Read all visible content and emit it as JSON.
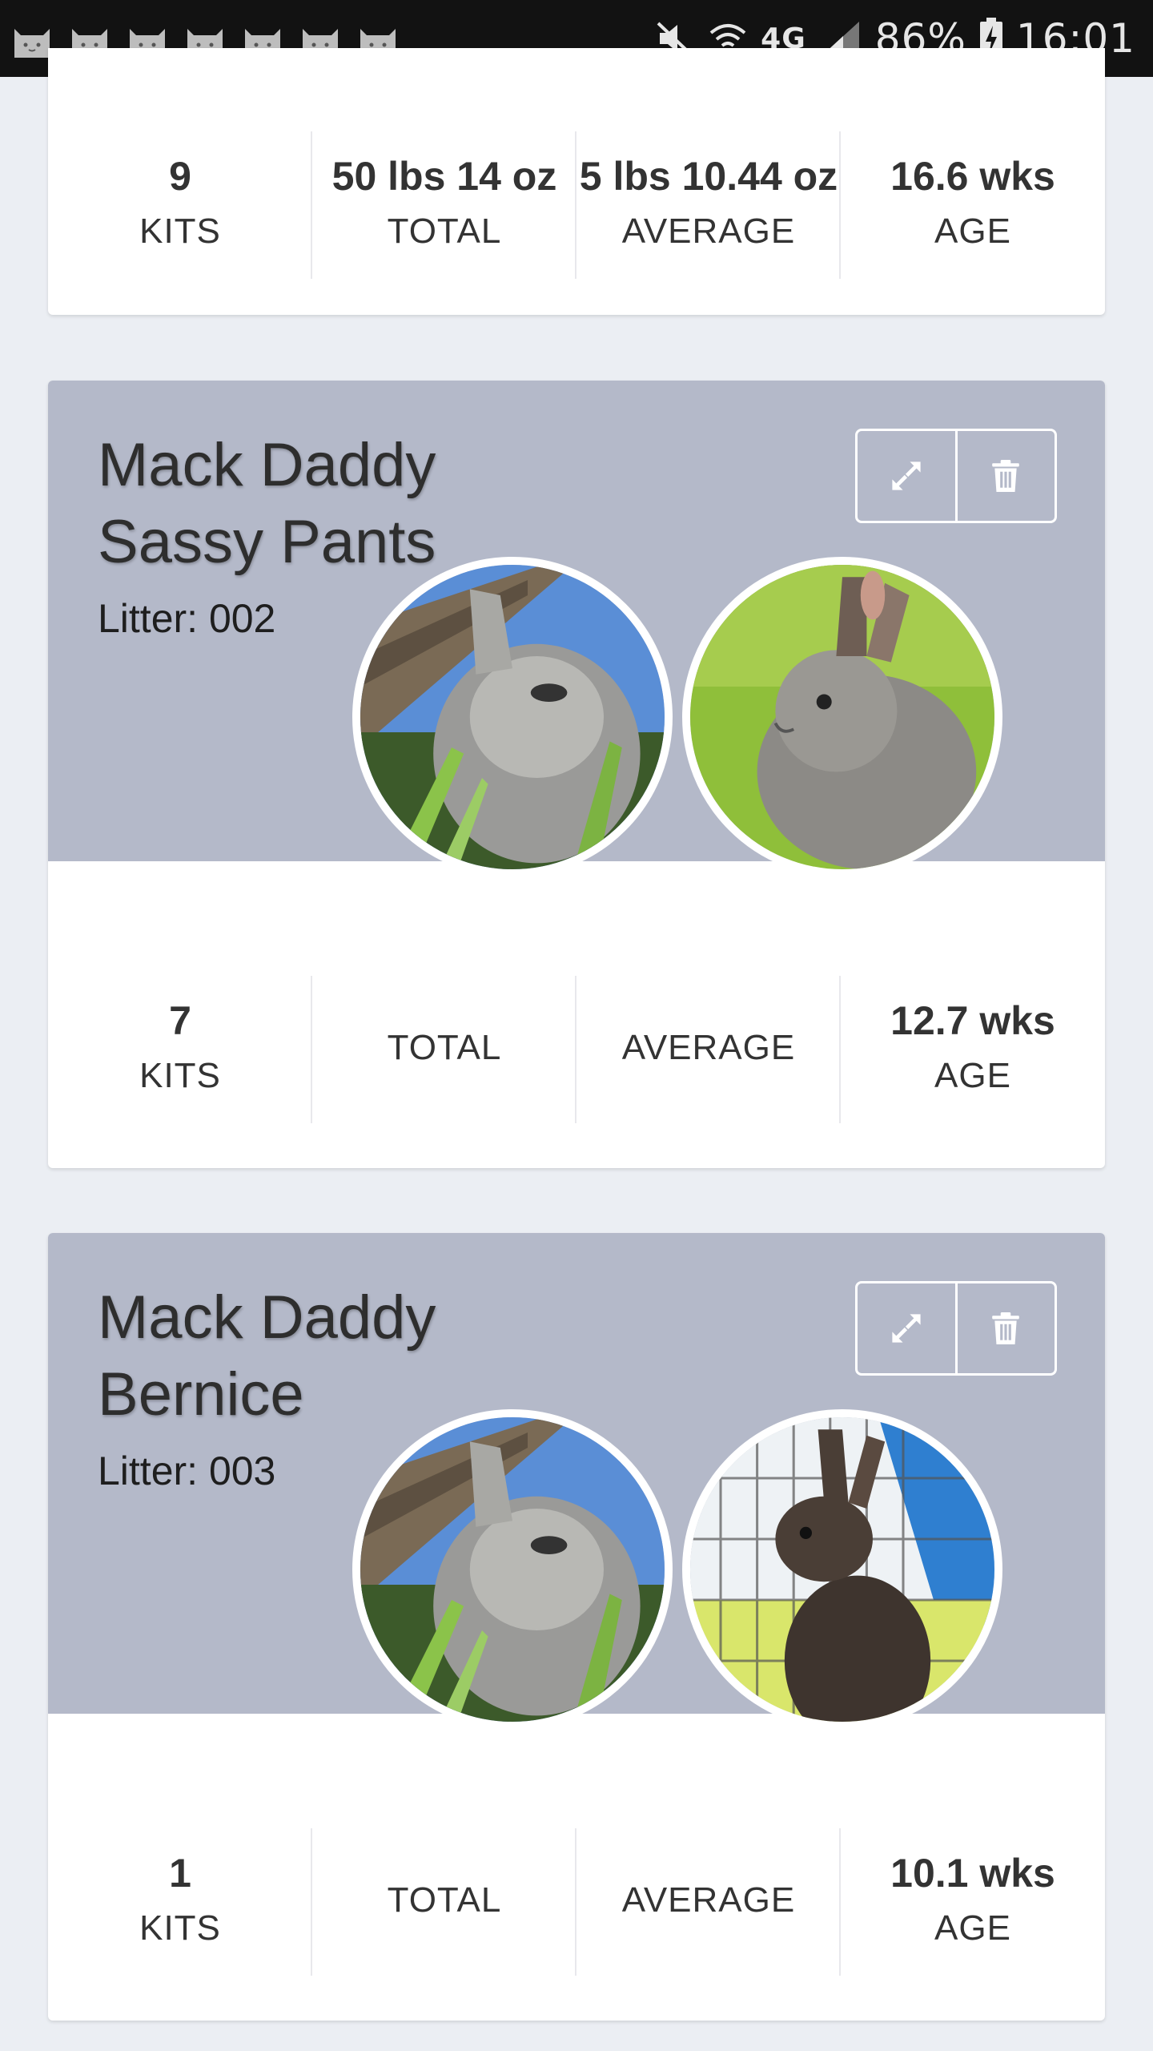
{
  "status_bar": {
    "notification_icons": [
      "cat-notification-icon",
      "cat-notification-icon",
      "cat-notification-icon",
      "cat-notification-icon",
      "cat-notification-icon",
      "cat-notification-icon",
      "cat-notification-icon"
    ],
    "network": "4G",
    "battery": "86%",
    "time": "16:01"
  },
  "colors": {
    "page_bg": "#ebeef3",
    "header_bg": "#b4b9c9",
    "card_bg": "#ffffff",
    "status_bg": "#121212"
  },
  "cards": [
    {
      "stats": [
        {
          "value": "9",
          "label": "KITS"
        },
        {
          "value": "50 lbs 14 oz",
          "label": "TOTAL"
        },
        {
          "value": "5 lbs 10.44 oz",
          "label": "AVERAGE"
        },
        {
          "value": "16.6 wks",
          "label": "AGE"
        }
      ]
    },
    {
      "sire": "Mack Daddy",
      "dam": "Sassy Pants",
      "litter": "Litter: 002",
      "expand_icon": "expand-icon",
      "delete_icon": "trash-icon",
      "stats": [
        {
          "value": "7",
          "label": "KITS"
        },
        {
          "value": "",
          "label": "TOTAL"
        },
        {
          "value": "",
          "label": "AVERAGE"
        },
        {
          "value": "12.7 wks",
          "label": "AGE"
        }
      ]
    },
    {
      "sire": "Mack Daddy",
      "dam": "Bernice",
      "litter": "Litter: 003",
      "expand_icon": "expand-icon",
      "delete_icon": "trash-icon",
      "stats": [
        {
          "value": "1",
          "label": "KITS"
        },
        {
          "value": "",
          "label": "TOTAL"
        },
        {
          "value": "",
          "label": "AVERAGE"
        },
        {
          "value": "10.1 wks",
          "label": "AGE"
        }
      ]
    }
  ]
}
